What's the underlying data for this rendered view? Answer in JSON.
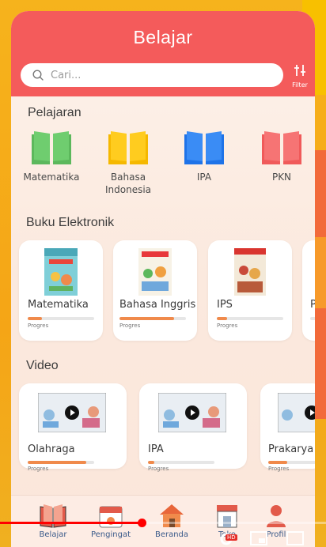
{
  "header": {
    "title": "Belajar",
    "filter_label": "Filter"
  },
  "search": {
    "placeholder": "Cari..."
  },
  "pelajaran": {
    "title": "Pelajaran",
    "items": [
      {
        "label": "Matematika",
        "color": "#5cb85c"
      },
      {
        "label": "Bahasa\nIndonesia",
        "color": "#f5b800"
      },
      {
        "label": "IPA",
        "color": "#1e73e8"
      },
      {
        "label": "PKN",
        "color": "#f05a5a"
      }
    ]
  },
  "buku": {
    "title": "Buku Elektronik",
    "items": [
      {
        "label": "Matematika",
        "progress_label": "Progres",
        "progress": 0.22
      },
      {
        "label": "Bahasa Inggris",
        "progress_label": "Progres",
        "progress": 0.82
      },
      {
        "label": "IPS",
        "progress_label": "Progres",
        "progress": 0.15
      },
      {
        "label": "P",
        "progress_label": "",
        "progress": 0
      }
    ]
  },
  "video": {
    "title": "Video",
    "items": [
      {
        "label": "Olahraga",
        "progress_label": "Progres",
        "progress": 0.88
      },
      {
        "label": "IPA",
        "progress_label": "Progres",
        "progress": 0.1
      },
      {
        "label": "Prakarya",
        "progress_label": "Progres",
        "progress": 0.4
      }
    ]
  },
  "bottom_nav": [
    {
      "label": "Belajar",
      "icon": "book-icon"
    },
    {
      "label": "Pengingat",
      "icon": "calendar-icon"
    },
    {
      "label": "Beranda",
      "icon": "home-icon"
    },
    {
      "label": "Toko",
      "icon": "store-icon"
    },
    {
      "label": "Profil",
      "icon": "user-icon"
    }
  ],
  "player": {
    "hd_badge": "HD"
  },
  "colors": {
    "accent": "#f45b5b",
    "progress": "#f08a4b",
    "background": "#f6b31c"
  }
}
